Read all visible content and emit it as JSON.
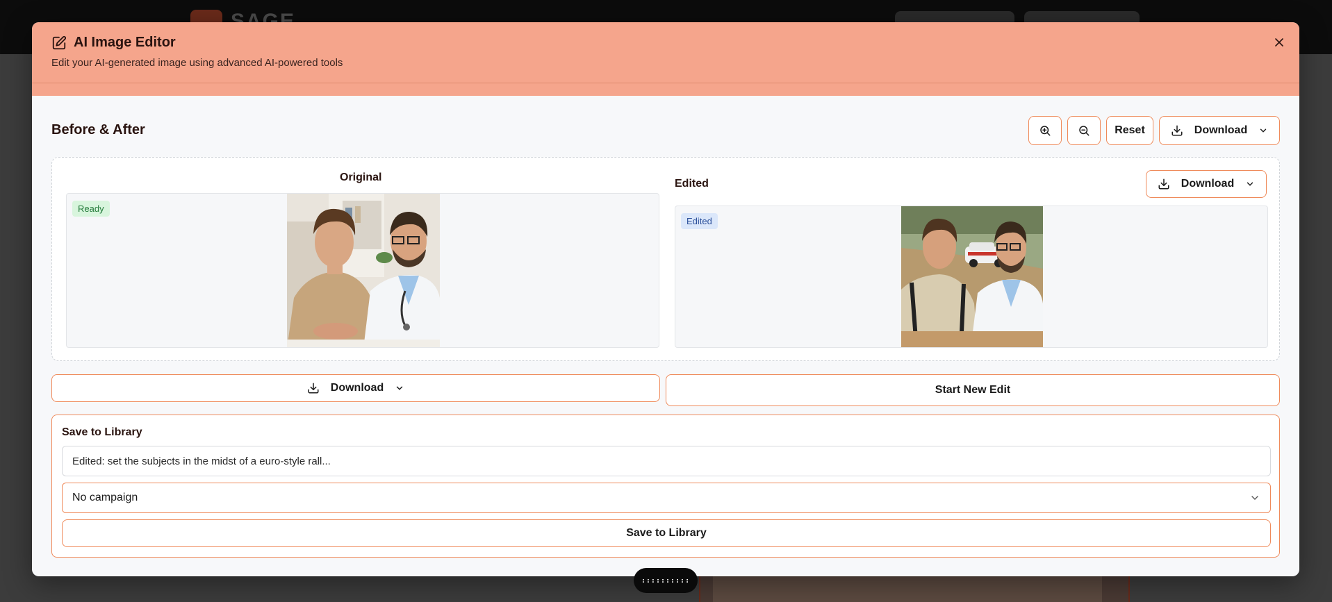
{
  "modal": {
    "title": "AI Image Editor",
    "subtitle": "Edit your AI-generated image using advanced AI-powered tools",
    "title_icon": "edit-icon",
    "close_icon": "close-icon"
  },
  "compare": {
    "section_title": "Before & After",
    "toolbar": {
      "zoom_in_icon": "zoom-in-icon",
      "zoom_out_icon": "zoom-out-icon",
      "reset_label": "Reset",
      "download_label": "Download"
    },
    "original": {
      "label": "Original",
      "badge": "Ready"
    },
    "edited": {
      "label": "Edited",
      "badge": "Edited",
      "download_label": "Download"
    }
  },
  "actions": {
    "download_label": "Download",
    "start_new_edit_label": "Start New Edit"
  },
  "save_library": {
    "title": "Save to Library",
    "name_value": "Edited: set the subjects in the midst of a euro-style rall...",
    "campaign_value": "No campaign",
    "save_label": "Save to Library"
  },
  "drag_handle": {
    "label": "::::::::::"
  },
  "colors": {
    "header_bg": "#f5a58c",
    "accent_border": "#ef8a5a",
    "ready_badge_bg": "#d8f5dd",
    "edited_badge_bg": "#dbe7fa"
  }
}
